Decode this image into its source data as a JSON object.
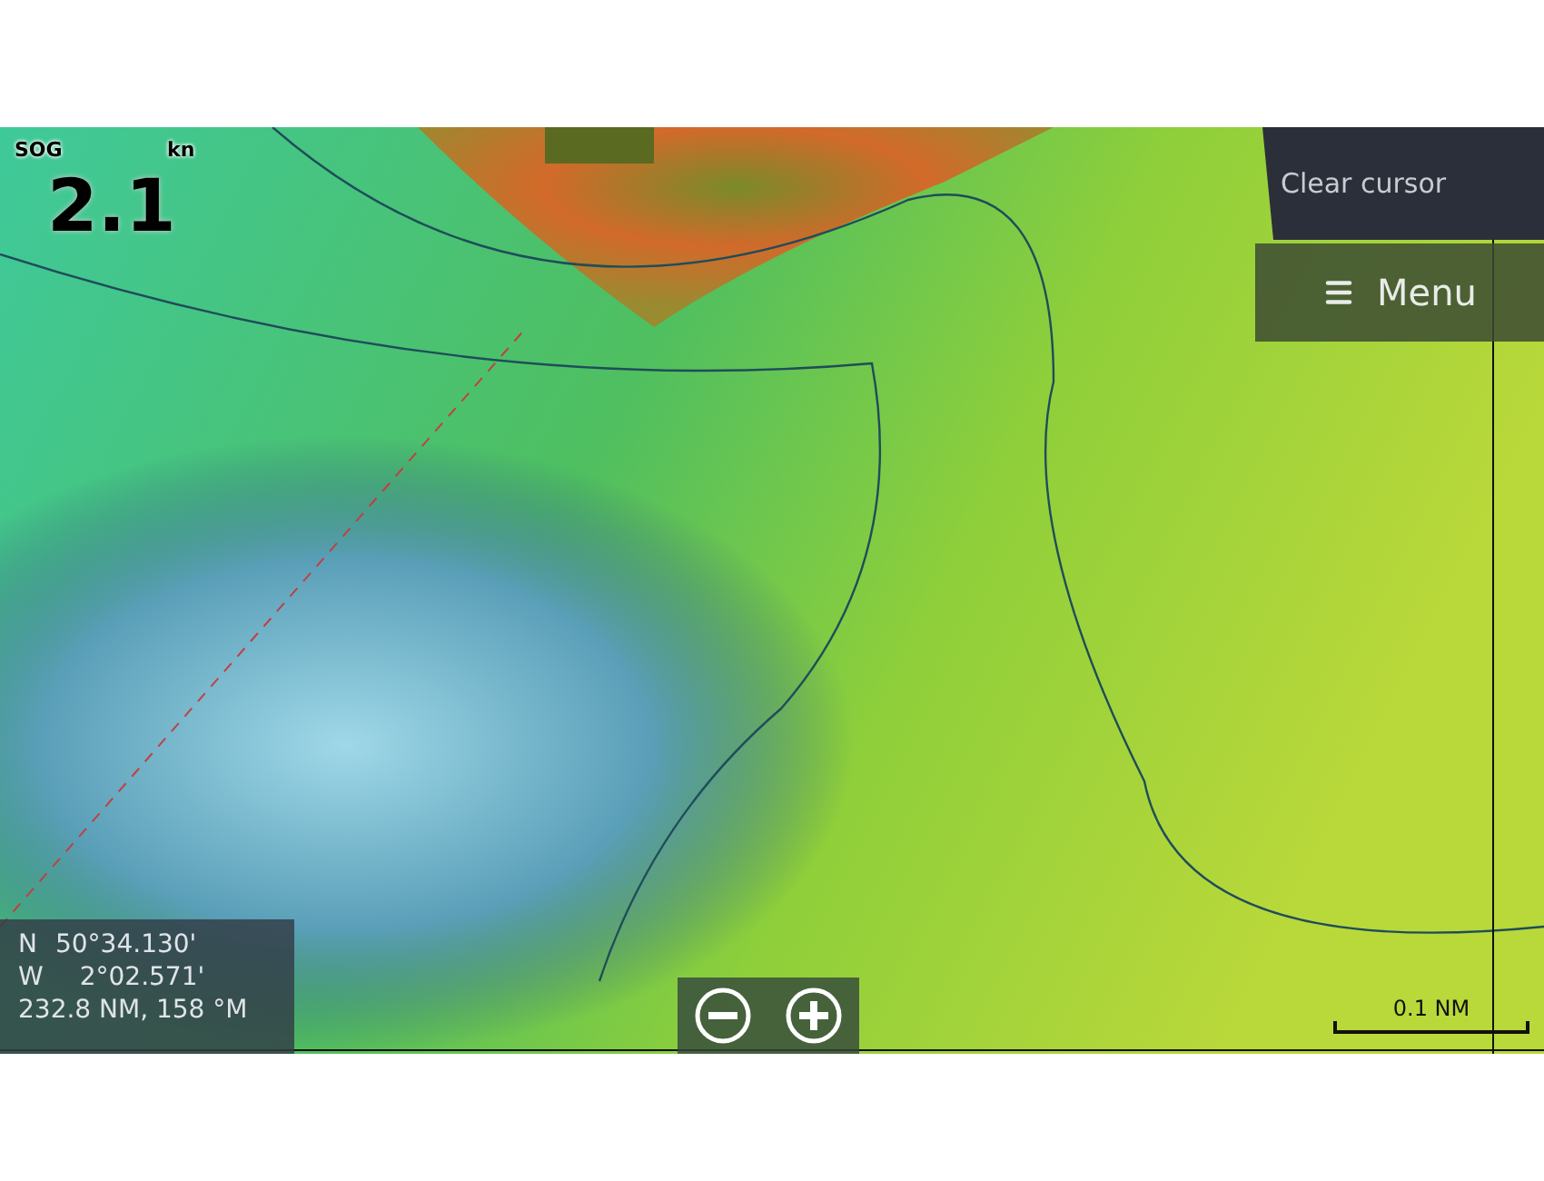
{
  "speed": {
    "label": "SOG",
    "unit": "kn",
    "value": "2.1"
  },
  "buttons": [
    {
      "kind": "clear",
      "label": "Clear cursor"
    },
    {
      "kind": "menu",
      "label": "Menu"
    }
  ],
  "position": {
    "lat_hemisphere": "N",
    "lat": "50°34.130'",
    "lon_hemisphere": "W",
    "lon": "2°02.571'",
    "range_bearing": "232.8 NM, 158 °M"
  },
  "scale": {
    "label": "0.1 NM"
  }
}
